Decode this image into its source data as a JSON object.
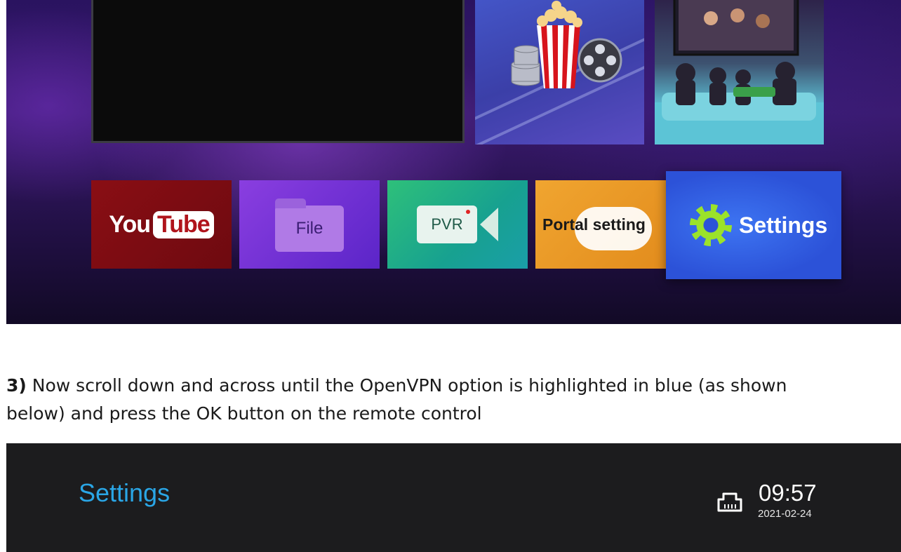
{
  "launcher": {
    "tiles": {
      "youtube": {
        "part1": "You",
        "part2": "Tube"
      },
      "file": "File",
      "pvr": "PVR",
      "portal": "Portal setting",
      "settings": "Settings"
    }
  },
  "instruction": {
    "step": "3)",
    "text": " Now scroll down and across until the OpenVPN option is highlighted in blue (as shown below) and press the OK button on the remote control",
    "line1": " Now scroll down and across until the OpenVPN option is highlighted in blue (as shown",
    "line2": "below) and press the OK button on the remote control"
  },
  "settings_screen": {
    "title": "Settings",
    "network_icon": "ethernet-icon",
    "time": "09:57",
    "date": "2021-02-24"
  },
  "colors": {
    "settings_title": "#2aa6e6",
    "settings_tile": "#2c52d8"
  }
}
